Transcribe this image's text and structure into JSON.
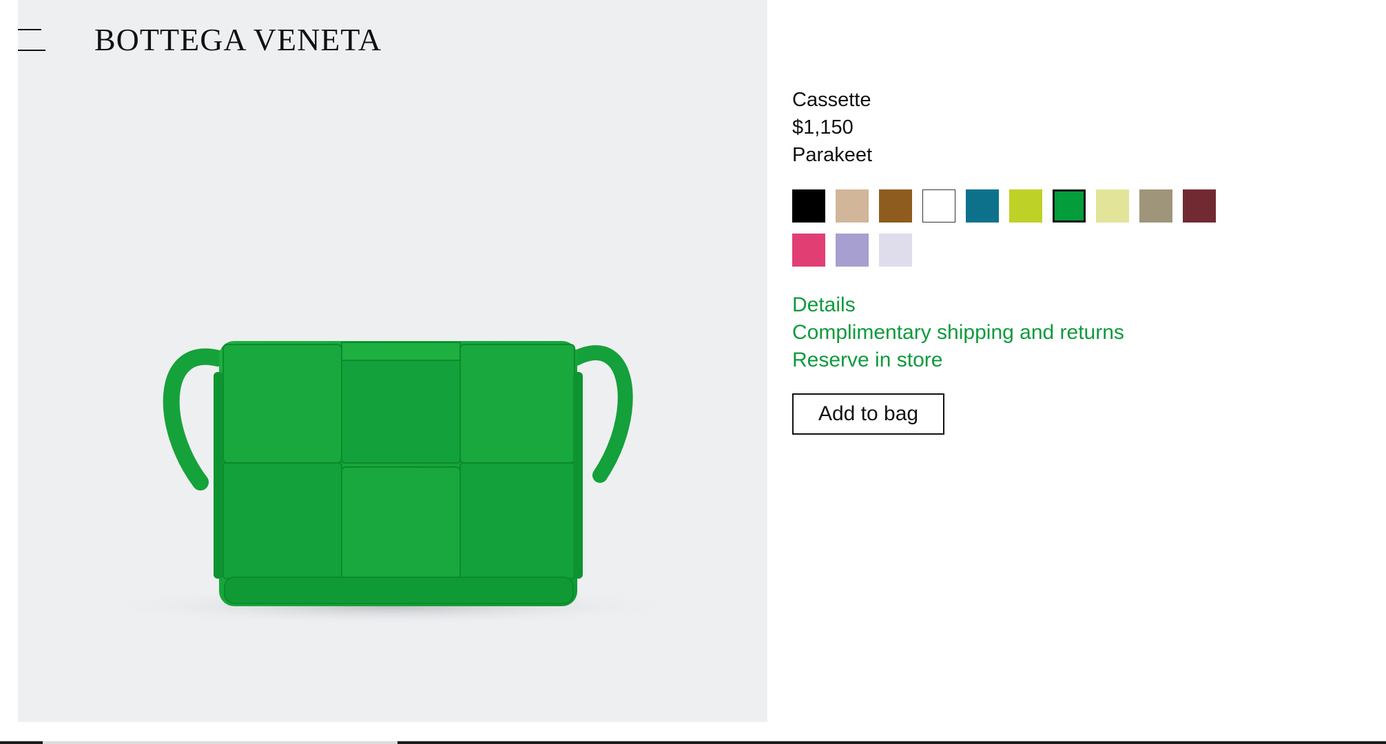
{
  "header": {
    "menu_icon": "hamburger-menu-icon",
    "brand": "BOTTEGA VENETA"
  },
  "product": {
    "name": "Cassette",
    "price": "$1,150",
    "color_name": "Parakeet",
    "image_icon": "green-intrecciato-cassette-bag"
  },
  "colors": {
    "selected_index": 6,
    "swatches": [
      {
        "hex": "#000000"
      },
      {
        "hex": "#d1b69a"
      },
      {
        "hex": "#8f5c1f"
      },
      {
        "hex": "#ffffff",
        "outlined": true
      },
      {
        "hex": "#0d718c"
      },
      {
        "hex": "#bed126"
      },
      {
        "hex": "#049d3c"
      },
      {
        "hex": "#e2e49a"
      },
      {
        "hex": "#9e957a"
      },
      {
        "hex": "#712a32"
      },
      {
        "hex": "#e13f74"
      },
      {
        "hex": "#a79fcf"
      },
      {
        "hex": "#dfdcec"
      }
    ]
  },
  "links": {
    "details": "Details",
    "shipping": "Complimentary shipping and returns",
    "reserve": "Reserve in store"
  },
  "actions": {
    "add_to_bag": "Add to bag"
  },
  "theme": {
    "accent": "#0e9a3d",
    "image_background": "#eeeff1"
  }
}
